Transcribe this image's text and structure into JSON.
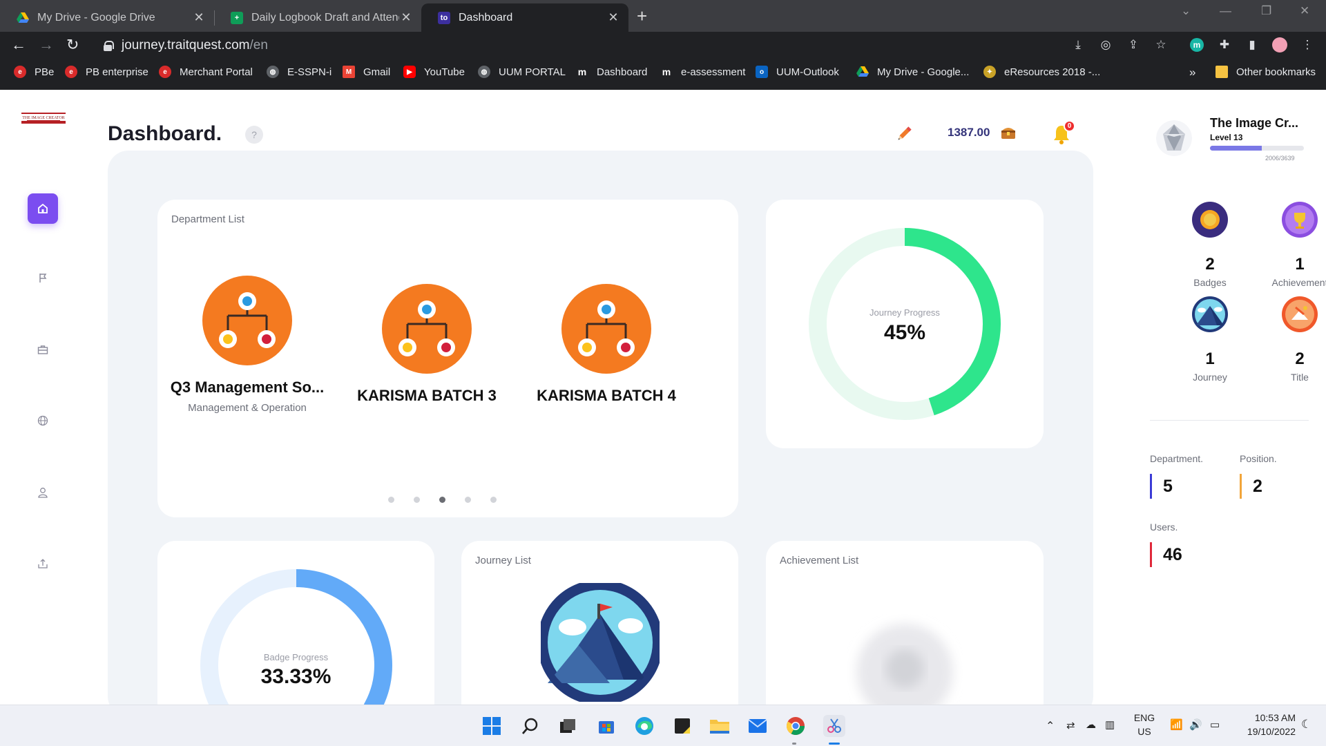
{
  "browser": {
    "tabs": [
      {
        "title": "My Drive - Google Drive",
        "icon": "google-drive-icon"
      },
      {
        "title": "Daily Logbook Draft and Attenda",
        "icon": "google-sheets-icon"
      },
      {
        "title": "Dashboard",
        "icon": "traitquest-icon",
        "active": true
      }
    ],
    "url_host": "journey.traitquest.com",
    "url_path": "/en",
    "bookmarks": [
      {
        "label": "PBe",
        "icon": "pb-icon"
      },
      {
        "label": "PB enterprise",
        "icon": "pb-icon"
      },
      {
        "label": "Merchant Portal",
        "icon": "pb-icon"
      },
      {
        "label": "E-SSPN-i",
        "icon": "globe-icon"
      },
      {
        "label": "Gmail",
        "icon": "gmail-icon"
      },
      {
        "label": "YouTube",
        "icon": "youtube-icon"
      },
      {
        "label": "UUM PORTAL",
        "icon": "globe-icon"
      },
      {
        "label": "Dashboard",
        "icon": "m-icon"
      },
      {
        "label": "e-assessment",
        "icon": "m-icon"
      },
      {
        "label": "UUM-Outlook",
        "icon": "outlook-icon"
      },
      {
        "label": "My Drive - Google...",
        "icon": "google-drive-icon"
      },
      {
        "label": "eResources 2018 -...",
        "icon": "seal-icon"
      }
    ],
    "more_bookmarks": "»",
    "other_bookmarks": "Other bookmarks"
  },
  "header": {
    "title": "Dashboard.",
    "help": "?",
    "coins": "1387.00",
    "notifications": "0"
  },
  "brand": {
    "logo_text": "The Image Creator"
  },
  "department_list": {
    "title": "Department List",
    "items": [
      {
        "name": "Q3 Management So...",
        "subtitle": "Management & Operation"
      },
      {
        "name": "KARISMA BATCH 3",
        "subtitle": ""
      },
      {
        "name": "KARISMA BATCH 4",
        "subtitle": ""
      }
    ],
    "pagination": {
      "count": 5,
      "active_index": 2
    }
  },
  "journey_progress": {
    "label": "Journey Progress",
    "value": "45%",
    "fraction": 0.45,
    "color": "#2ee58c"
  },
  "badge_progress": {
    "label": "Badge Progress",
    "value": "33.33%",
    "fraction": 0.3333,
    "color": "#62aaf8"
  },
  "journey_list": {
    "title": "Journey List"
  },
  "achievement_list": {
    "title": "Achievement List"
  },
  "profile": {
    "name": "The Image Cr...",
    "level": "Level 13",
    "xp_text": "2006/3639",
    "xp_fraction": 0.551
  },
  "stats": [
    {
      "value": "2",
      "label": "Badges",
      "icon": "badge-medal-icon"
    },
    {
      "value": "1",
      "label": "Achievement",
      "icon": "trophy-icon"
    },
    {
      "value": "1",
      "label": "Journey",
      "icon": "mountain-icon"
    },
    {
      "value": "2",
      "label": "Title",
      "icon": "title-hand-icon"
    }
  ],
  "kpis": [
    {
      "label": "Department.",
      "value": "5",
      "color": "#3b3bd6"
    },
    {
      "label": "Position.",
      "value": "2",
      "color": "#f2a53a"
    },
    {
      "label": "Users.",
      "value": "46",
      "color": "#e0283a"
    }
  ],
  "taskbar": {
    "language": "ENG",
    "region": "US",
    "time": "10:53 AM",
    "date": "19/10/2022"
  },
  "colors": {
    "accent": "#7b4df0",
    "department_icon": "#f47a20"
  }
}
